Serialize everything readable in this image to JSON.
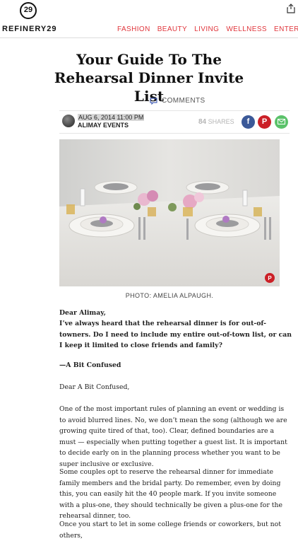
{
  "header": {
    "logo_mark": "29",
    "logo_text": "REFINERY29",
    "nav": [
      "FASHION",
      "BEAUTY",
      "LIVING",
      "WELLNESS",
      "ENTERTAI"
    ]
  },
  "article": {
    "title": "Your Guide To The Rehearsal Dinner Invite List",
    "comments_label": "COMMENTS",
    "date": "AUG 6, 2014 11:00 PM",
    "author": "ALIMAY EVENTS",
    "shares_count": "84",
    "shares_label": "SHARES",
    "photo_caption": "PHOTO: AMELIA ALPAUGH.",
    "greeting": "Dear Alimay,",
    "question": "I’ve always heard that the rehearsal dinner is for out-of-towners. Do I need to include my entire out-of-town list, or can I keep it limited to close friends and family?",
    "signoff": "—A Bit Confused",
    "reply_greeting": "Dear A Bit Confused,",
    "p1": "One of the most important rules of planning an event or wedding is to avoid blurred lines. No, we don’t mean the song (although we are growing quite tired of that, too). Clear, defined boundaries are a must — especially when putting together a guest list. It is important to decide early on in the planning process whether you want to be super inclusive or exclusive.",
    "p2": "Some couples opt to reserve the rehearsal dinner for immediate family members and the bridal party. Do remember, even by doing this, you can easily hit the 40 people mark. If you invite someone with a plus-one, they should technically be given a plus-one for the rehearsal dinner, too.",
    "p3": "Once you start to let in some college friends or coworkers, but not others,"
  },
  "colors": {
    "accent": "#e0363c",
    "facebook": "#3b5998",
    "pinterest": "#cb2027",
    "email": "#5bc26a"
  },
  "icons": [
    "share-icon",
    "comment-icon",
    "facebook-icon",
    "pinterest-icon",
    "email-icon"
  ]
}
